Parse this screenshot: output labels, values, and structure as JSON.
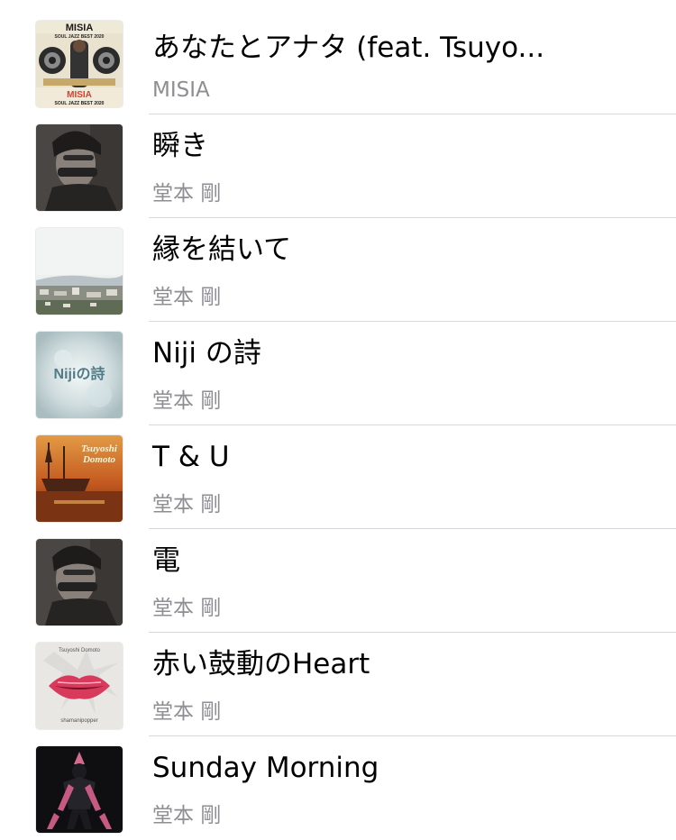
{
  "songs": [
    {
      "title": "あなたとアナタ (feat. Tsuyo...",
      "artist": "MISIA",
      "art": "misia-soul-jazz-best-2020-cover",
      "art_text_top": "MISIA",
      "art_text_sub": "SOUL JAZZ BEST 2020",
      "art_text_bottom": "MISIA",
      "art_text_bottom_sub": "SOUL JAZZ BEST 2020"
    },
    {
      "title": "瞬き",
      "artist": "堂本 剛",
      "art": "portrait-hand-over-face-cover"
    },
    {
      "title": "縁を結いて",
      "artist": "堂本 剛",
      "art": "city-landscape-cover"
    },
    {
      "title": "Niji の詩",
      "artist": "堂本 剛",
      "art": "niji-no-uta-cover",
      "art_text": "Nijiの詩"
    },
    {
      "title": "T & U",
      "artist": "堂本 剛",
      "art": "tsuyoshi-domoto-ship-cover",
      "art_text_top": "Tsuyoshi",
      "art_text_bottom": "Domoto"
    },
    {
      "title": "電",
      "artist": "堂本 剛",
      "art": "portrait-hand-over-face-cover"
    },
    {
      "title": "赤い鼓動のHeart",
      "artist": "堂本 剛",
      "art": "red-lips-cover",
      "art_text_top": "Tsuyoshi Domoto",
      "art_text_bottom": "shamanipopper"
    },
    {
      "title": "Sunday Morning",
      "artist": "堂本 剛",
      "art": "dark-figure-cover"
    }
  ],
  "colors": {
    "title": "#000000",
    "artist": "#8e8e93",
    "separator": "#d8d8dc",
    "background": "#ffffff"
  }
}
